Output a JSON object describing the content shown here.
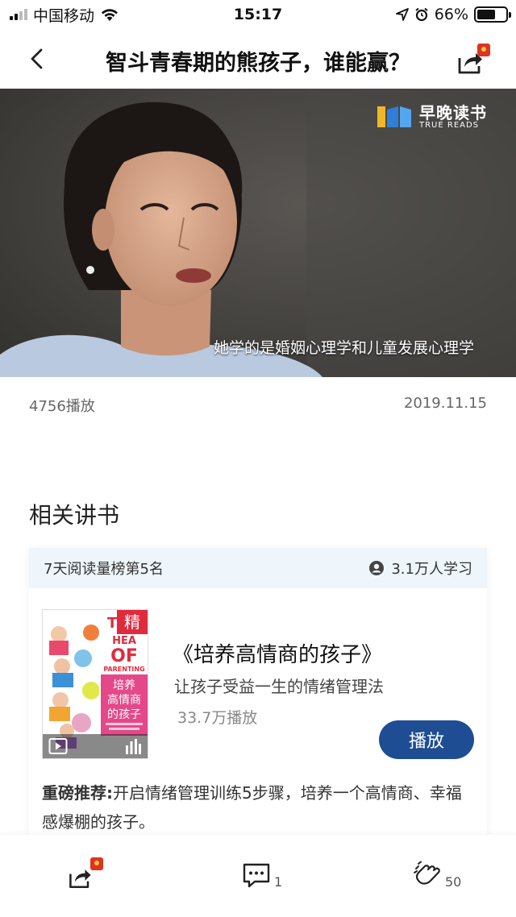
{
  "status_bar": {
    "carrier": "中国移动",
    "time": "15:17",
    "battery": "66%",
    "battery_level": 0.66
  },
  "nav": {
    "title": "智斗青春期的熊孩子，谁能赢？"
  },
  "video": {
    "logo_main": "早晚读书",
    "logo_sub": "TRUE READS",
    "subtitle": "她学的是婚姻心理学和儿童发展心理学"
  },
  "meta": {
    "plays": "4756播放",
    "date": "2019.11.15"
  },
  "related": {
    "section_title": "相关讲书",
    "rank": "7天阅读量榜第5名",
    "learners": "3.1万人学习",
    "book_title": "《培养高情商的孩子》",
    "book_subtitle": "让孩子受益一生的情绪管理法",
    "book_plays": "33.7万播放",
    "play_label": "播放",
    "recommend_label": "重磅推荐:",
    "recommend_text": "开启情绪管理训练5步骤，培养一个高情商、幸福感爆棚的孩子。",
    "cover": {
      "badge": "精",
      "line1": "T",
      "line2": "HEA",
      "line3": "OF",
      "line4": "PARENTING",
      "cn_title": "培养\n高情商\n的孩子"
    }
  },
  "bottom_bar": {
    "comment_count": "1",
    "like_count": "50"
  },
  "colors": {
    "accent": "#1e4d94",
    "badge_red": "#e0321e",
    "card_header_bg": "#eef6fb",
    "cover_pink": "#e5488a"
  }
}
